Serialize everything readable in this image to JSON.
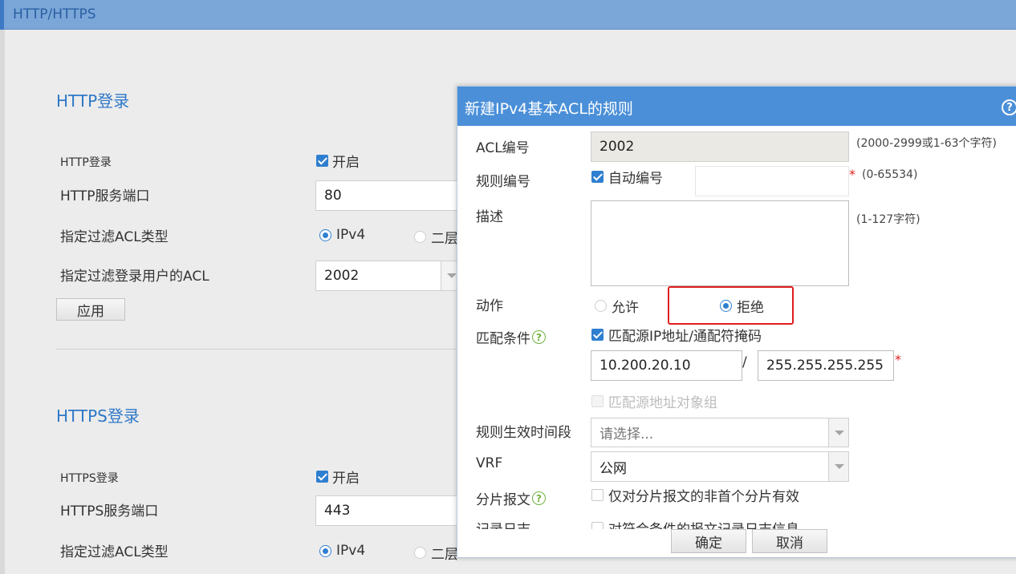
{
  "window": {
    "title": "HTTP/HTTPS"
  },
  "http": {
    "section_title": "HTTP登录",
    "login_label": "HTTP登录",
    "enable_label": "开启",
    "port_label": "HTTP服务端口",
    "port_value": "80",
    "acl_type_label": "指定过滤ACL类型",
    "acl_type_opt1": "IPv4",
    "acl_type_opt2": "二层",
    "acl_label": "指定过滤登录用户的ACL",
    "acl_value": "2002",
    "apply_label": "应用"
  },
  "https": {
    "section_title": "HTTPS登录",
    "login_label": "HTTPS登录",
    "enable_label": "开启",
    "port_label": "HTTPS服务端口",
    "port_value": "443",
    "acl_type_label": "指定过滤ACL类型",
    "acl_type_opt1": "IPv4",
    "acl_type_opt2": "二层"
  },
  "dialog": {
    "title": "新建IPv4基本ACL的规则",
    "help_icon": "?",
    "acl_no_label": "ACL编号",
    "acl_no_value": "2002",
    "acl_no_hint": "(2000-2999或1-63个字符)",
    "rule_no_label": "规则编号",
    "rule_auto_label": "自动编号",
    "rule_no_hint": "(0-65534)",
    "required_mark": "*",
    "desc_label": "描述",
    "desc_hint": "(1-127字符)",
    "action_label": "动作",
    "action_permit": "允许",
    "action_deny": "拒绝",
    "action_selected": "拒绝",
    "match_label": "匹配条件",
    "match_src_ip_label": "匹配源IP地址/通配符掩码",
    "src_ip_value": "10.200.20.10",
    "slash": "/",
    "wildcard_value": "255.255.255.255",
    "match_src_group_label": "匹配源地址对象组",
    "time_range_label": "规则生效时间段",
    "time_range_placeholder": "请选择...",
    "vrf_label": "VRF",
    "vrf_value": "公网",
    "fragment_label": "分片报文",
    "fragment_option": "仅对分片报文的非首个分片有效",
    "log_label_partial": "记录日志",
    "log_option_partial": "对符合条件的报文记录日志信息",
    "ok_label": "确定",
    "cancel_label": "取消"
  },
  "colors": {
    "titlebar": "#7aa6d8",
    "dialog_header": "#4a8fd8",
    "accent_blue": "#2f7fd0",
    "highlight_red": "#e01d1d"
  }
}
